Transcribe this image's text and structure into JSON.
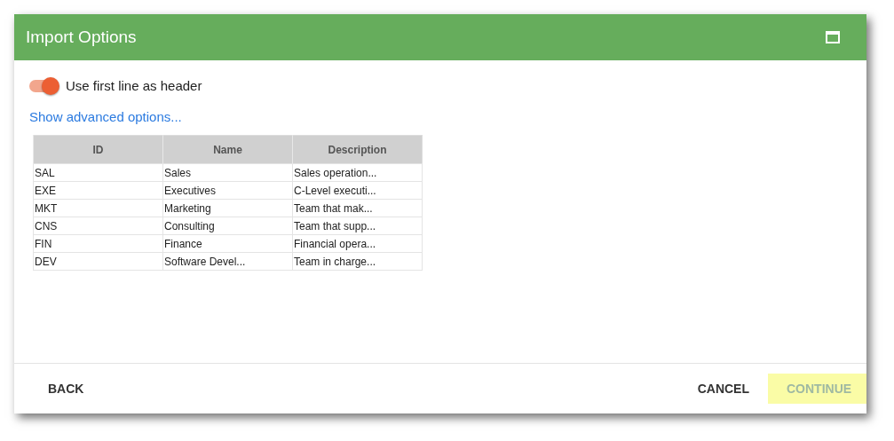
{
  "window": {
    "title": "Import Options"
  },
  "header_toggle": {
    "label": "Use first line as header",
    "on": true
  },
  "advanced_link": "Show advanced options...",
  "table": {
    "columns": [
      "ID",
      "Name",
      "Description"
    ],
    "rows": [
      [
        "SAL",
        "Sales",
        "Sales operation..."
      ],
      [
        "EXE",
        "Executives",
        "C-Level executi..."
      ],
      [
        "MKT",
        "Marketing",
        "Team that mak..."
      ],
      [
        "CNS",
        "Consulting",
        "Team that supp..."
      ],
      [
        "FIN",
        "Finance",
        "Financial opera..."
      ],
      [
        "DEV",
        "Software Devel...",
        "Team in charge..."
      ]
    ]
  },
  "buttons": {
    "back": {
      "label": "BACK",
      "disabled": false
    },
    "cancel": {
      "label": "CANCEL",
      "disabled": false
    },
    "continue": {
      "label": "CONTINUE",
      "disabled": true
    }
  }
}
